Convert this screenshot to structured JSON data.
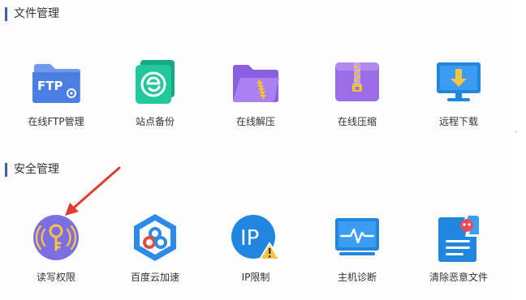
{
  "sections": [
    {
      "title": "文件管理",
      "items": [
        {
          "label": "在线FTP管理",
          "icon": "ftp-folder-icon",
          "badge": "FTP"
        },
        {
          "label": "站点备份",
          "icon": "site-backup-icon"
        },
        {
          "label": "在线解压",
          "icon": "online-unzip-icon"
        },
        {
          "label": "在线压缩",
          "icon": "online-compress-icon"
        },
        {
          "label": "远程下载",
          "icon": "remote-download-icon"
        }
      ]
    },
    {
      "title": "安全管理",
      "items": [
        {
          "label": "读写权限",
          "icon": "read-write-permission-icon"
        },
        {
          "label": "百度云加速",
          "icon": "baidu-cloud-acceleration-icon"
        },
        {
          "label": "IP限制",
          "icon": "ip-restriction-icon",
          "badge": "IP"
        },
        {
          "label": "主机诊断",
          "icon": "host-diagnosis-icon"
        },
        {
          "label": "清除恶意文件",
          "icon": "clear-malicious-files-icon"
        }
      ]
    }
  ],
  "colors": {
    "section_bar": "#3f5fb0",
    "ftp_blue": "#4a7ee0",
    "backup_green": "#1fc29a",
    "archive_purple": "#9b6ee8",
    "monitor_blue": "#2186de",
    "key_purple": "#7b6fe2",
    "annotation_red": "#e23c2c"
  }
}
